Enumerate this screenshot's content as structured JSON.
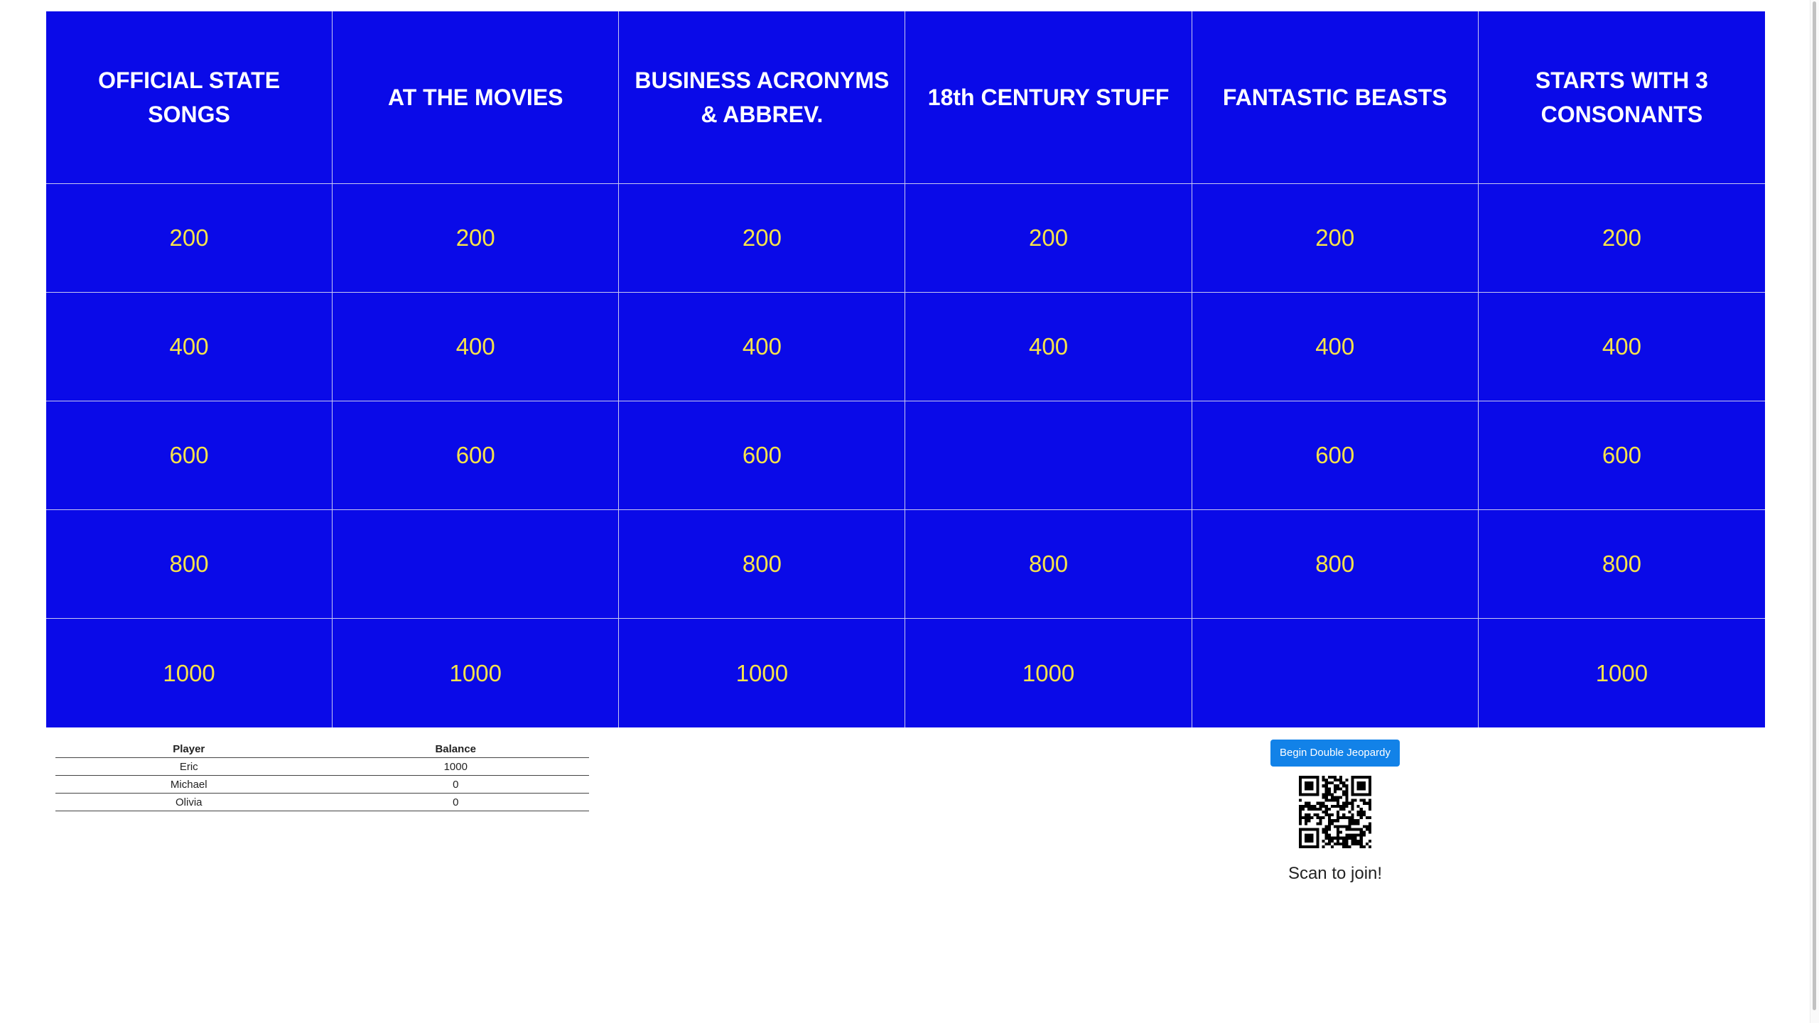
{
  "board": {
    "categories": [
      "OFFICIAL STATE SONGS",
      "AT THE MOVIES",
      "BUSINESS ACRONYMS & ABBREV.",
      "18th CENTURY STUFF",
      "FANTASTIC BEASTS",
      "STARTS WITH 3 CONSONANTS"
    ],
    "rows": [
      [
        "200",
        "200",
        "200",
        "200",
        "200",
        "200"
      ],
      [
        "400",
        "400",
        "400",
        "400",
        "400",
        "400"
      ],
      [
        "600",
        "600",
        "600",
        "",
        "600",
        "600"
      ],
      [
        "800",
        "",
        "800",
        "800",
        "800",
        "800"
      ],
      [
        "1000",
        "1000",
        "1000",
        "1000",
        "",
        "1000"
      ]
    ]
  },
  "scoreboard": {
    "headers": {
      "player": "Player",
      "balance": "Balance"
    },
    "rows": [
      {
        "player": "Eric",
        "balance": "1000"
      },
      {
        "player": "Michael",
        "balance": "0"
      },
      {
        "player": "Olivia",
        "balance": "0"
      }
    ]
  },
  "controls": {
    "double_jeopardy_label": "Begin Double Jeopardy",
    "qr_icon": "qr-code-icon",
    "scan_text": "Scan to join!"
  },
  "colors": {
    "board_blue": "#0a0ae8",
    "value_yellow": "#f7e34a",
    "category_white": "#ffffff",
    "button_blue": "#1282e8"
  }
}
